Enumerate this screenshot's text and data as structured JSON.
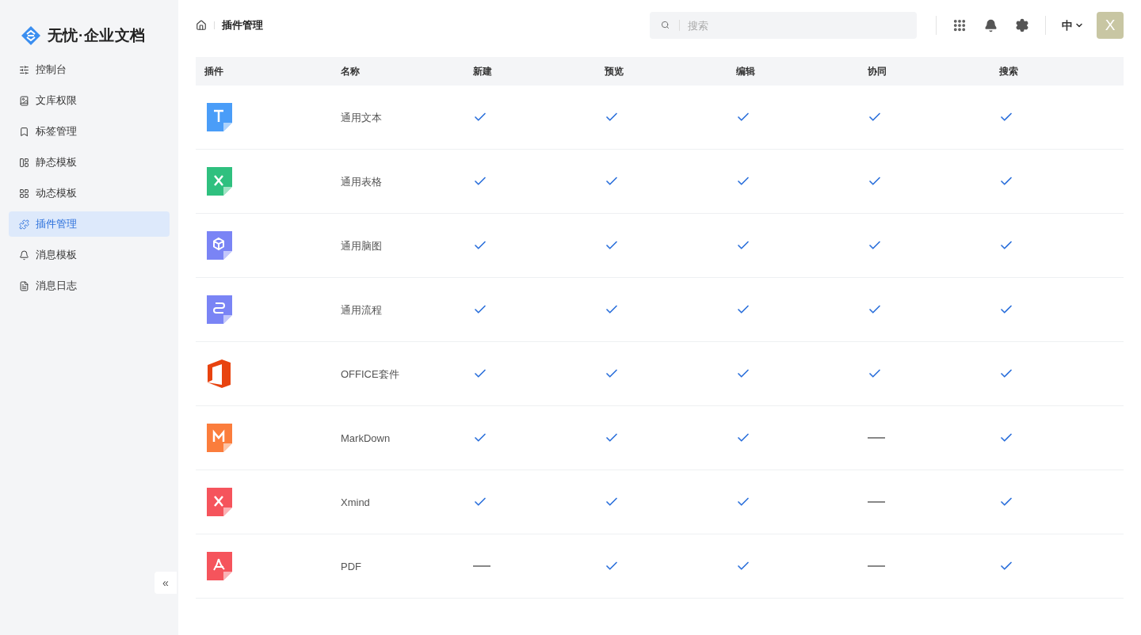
{
  "brand": {
    "name": "无忧·企业文档"
  },
  "sidebar": {
    "items": [
      {
        "label": "控制台",
        "selected": false
      },
      {
        "label": "文库权限",
        "selected": false
      },
      {
        "label": "标签管理",
        "selected": false
      },
      {
        "label": "静态模板",
        "selected": false
      },
      {
        "label": "动态模板",
        "selected": false
      },
      {
        "label": "插件管理",
        "selected": true
      },
      {
        "label": "消息模板",
        "selected": false
      },
      {
        "label": "消息日志",
        "selected": false
      }
    ],
    "collapse": "«"
  },
  "breadcrumb": {
    "current": "插件管理"
  },
  "search": {
    "placeholder": "搜索"
  },
  "header": {
    "language": "中",
    "avatar": "X"
  },
  "table": {
    "columns": [
      "插件",
      "名称",
      "新建",
      "预览",
      "编辑",
      "协同",
      "搜索"
    ],
    "rows": [
      {
        "kind": "text",
        "name": "通用文本",
        "support": [
          true,
          true,
          true,
          true,
          true
        ]
      },
      {
        "kind": "sheet",
        "name": "通用表格",
        "support": [
          true,
          true,
          true,
          true,
          true
        ]
      },
      {
        "kind": "mind",
        "name": "通用脑图",
        "support": [
          true,
          true,
          true,
          true,
          true
        ]
      },
      {
        "kind": "flow",
        "name": "通用流程",
        "support": [
          true,
          true,
          true,
          true,
          true
        ]
      },
      {
        "kind": "office",
        "name": "OFFICE套件",
        "support": [
          true,
          true,
          true,
          true,
          true
        ]
      },
      {
        "kind": "markdown",
        "name": "MarkDown",
        "support": [
          true,
          true,
          true,
          false,
          true
        ]
      },
      {
        "kind": "xmind",
        "name": "Xmind",
        "support": [
          true,
          true,
          true,
          false,
          true
        ]
      },
      {
        "kind": "pdf",
        "name": "PDF",
        "support": [
          false,
          true,
          true,
          false,
          true
        ]
      }
    ]
  }
}
